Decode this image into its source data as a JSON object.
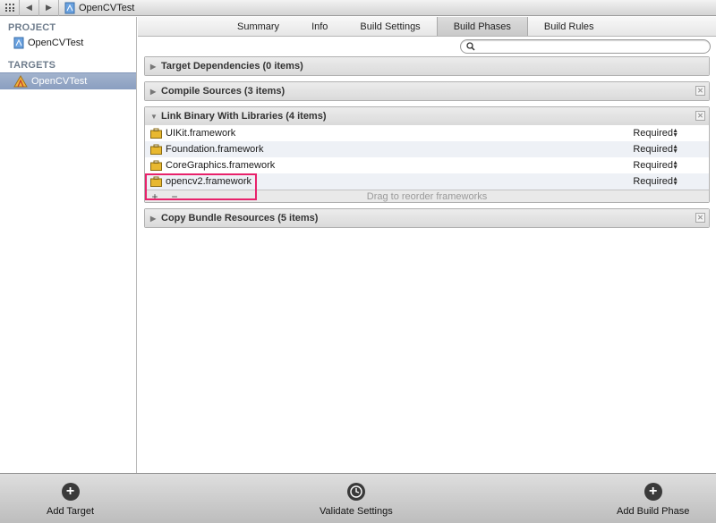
{
  "project": {
    "name": "OpenCVTest"
  },
  "sidebar": {
    "project_header": "PROJECT",
    "project_item": "OpenCVTest",
    "targets_header": "TARGETS",
    "target_item": "OpenCVTest"
  },
  "tabs": [
    "Summary",
    "Info",
    "Build Settings",
    "Build Phases",
    "Build Rules"
  ],
  "active_tab": "Build Phases",
  "search": {
    "placeholder": ""
  },
  "phases": {
    "target_dependencies": "Target Dependencies (0 items)",
    "compile_sources": "Compile Sources (3 items)",
    "link_binary": "Link Binary With Libraries (4 items)",
    "copy_bundle": "Copy Bundle Resources (5 items)"
  },
  "frameworks": [
    {
      "name": "UIKit.framework",
      "status": "Required"
    },
    {
      "name": "Foundation.framework",
      "status": "Required"
    },
    {
      "name": "CoreGraphics.framework",
      "status": "Required"
    },
    {
      "name": "opencv2.framework",
      "status": "Required"
    }
  ],
  "link_footer": {
    "add": "+",
    "remove": "−",
    "hint": "Drag to reorder frameworks"
  },
  "bottom": {
    "add_target": "Add Target",
    "validate_settings": "Validate Settings",
    "add_build_phase": "Add Build Phase"
  },
  "colors": {
    "highlight": "#e8226b",
    "selection": "#8a9ec0"
  }
}
